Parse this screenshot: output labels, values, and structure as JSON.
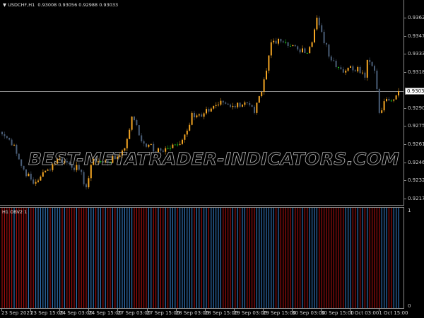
{
  "header": {
    "symbol": "USDCHF,H1",
    "ohlc": "0.93008 0.93056 0.92988 0.93033"
  },
  "indicator": {
    "title": "H1 OBV2 1",
    "axis_max": "1",
    "axis_min": "0"
  },
  "watermark": "BEST-METATRADER-INDICATORS.COM",
  "colors": {
    "bull": "#f5a623",
    "bear": "#4a5e78",
    "doji": "#19c019",
    "obv_up": "#2f6fb0",
    "obv_down": "#9a0e0e",
    "price_line": "#8a8a8a"
  },
  "chart_data": {
    "type": "candlestick",
    "symbol": "USDCHF",
    "timeframe": "H1",
    "current_price": "0.93033",
    "y_ticks": [
      "0.93620",
      "0.93475",
      "0.93330",
      "0.93185",
      "0.92900",
      "0.92755",
      "0.92610",
      "0.92465",
      "0.92320",
      "0.92175"
    ],
    "ylim": [
      0.9214,
      0.9366
    ],
    "x_ticks": [
      "23 Sep 2021",
      "23 Sep 15:00",
      "24 Sep 03:00",
      "24 Sep 15:00",
      "27 Sep 03:00",
      "27 Sep 15:00",
      "28 Sep 03:00",
      "28 Sep 15:00",
      "29 Sep 03:00",
      "29 Sep 15:00",
      "30 Sep 03:00",
      "30 Sep 15:00",
      "1 Oct 03:00",
      "1 Oct 15:00"
    ],
    "bars_total": 166,
    "close_keypoints": [
      [
        0,
        0.92689
      ],
      [
        2,
        0.92661
      ],
      [
        5,
        0.92605
      ],
      [
        8,
        0.92436
      ],
      [
        13,
        0.92295
      ],
      [
        16,
        0.92351
      ],
      [
        19,
        0.92407
      ],
      [
        23,
        0.92492
      ],
      [
        27,
        0.92464
      ],
      [
        32,
        0.92407
      ],
      [
        35,
        0.92266
      ],
      [
        38,
        0.92492
      ],
      [
        42,
        0.92464
      ],
      [
        47,
        0.92492
      ],
      [
        51,
        0.92577
      ],
      [
        54,
        0.9283
      ],
      [
        55,
        0.92802
      ],
      [
        58,
        0.92633
      ],
      [
        61,
        0.92605
      ],
      [
        64,
        0.92548
      ],
      [
        69,
        0.92577
      ],
      [
        73,
        0.92605
      ],
      [
        77,
        0.92718
      ],
      [
        79,
        0.92859
      ],
      [
        83,
        0.9283
      ],
      [
        88,
        0.92915
      ],
      [
        92,
        0.92943
      ],
      [
        96,
        0.92915
      ],
      [
        101,
        0.92943
      ],
      [
        105,
        0.92859
      ],
      [
        108,
        0.93028
      ],
      [
        110,
        0.93197
      ],
      [
        112,
        0.93423
      ],
      [
        115,
        0.93451
      ],
      [
        118,
        0.93423
      ],
      [
        123,
        0.93366
      ],
      [
        126,
        0.93338
      ],
      [
        129,
        0.93423
      ],
      [
        131,
        0.9362
      ],
      [
        133,
        0.93507
      ],
      [
        136,
        0.9331
      ],
      [
        139,
        0.93225
      ],
      [
        143,
        0.93197
      ],
      [
        148,
        0.93225
      ],
      [
        151,
        0.93141
      ],
      [
        152,
        0.93282
      ],
      [
        155,
        0.93197
      ],
      [
        157,
        0.92859
      ],
      [
        160,
        0.92971
      ],
      [
        164,
        0.92999
      ],
      [
        165,
        0.93033
      ]
    ],
    "indicator_range": [
      0,
      1
    ]
  }
}
